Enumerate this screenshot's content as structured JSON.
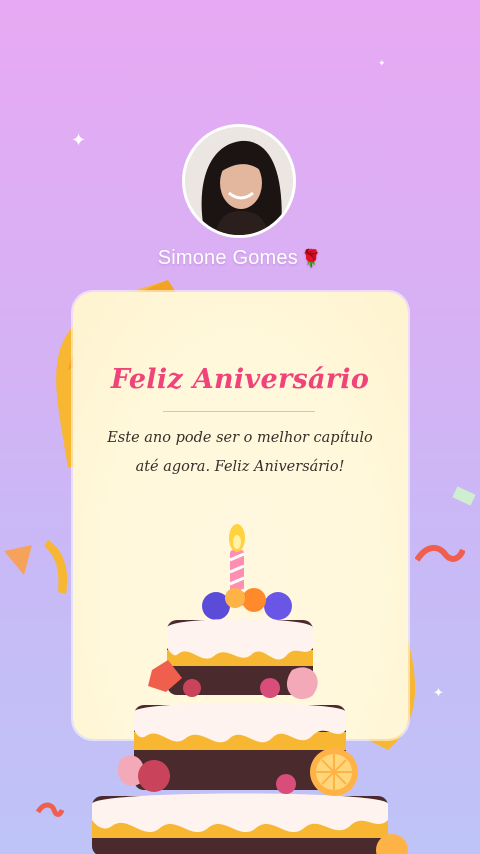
{
  "profile": {
    "name": "Simone Gomes",
    "name_emoji": "🌹",
    "avatar_icon": "person-photo"
  },
  "card": {
    "title": "Feliz Aniversário",
    "message": "Este ano pode ser o melhor capítulo até agora. Feliz Aniversário!"
  },
  "colors": {
    "background_top": "#e7a9f3",
    "background_bottom": "#bec4f7",
    "card_background": "#fff8db",
    "title_color": "#f0437a",
    "ribbon_color": "#f7b733"
  }
}
